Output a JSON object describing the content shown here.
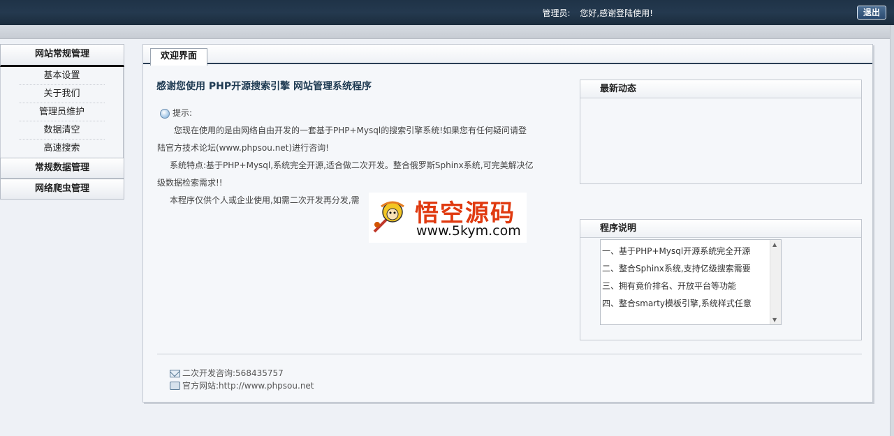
{
  "header": {
    "admin_label": "管理员:",
    "greeting": "您好,感谢登陆使用!",
    "logout_label": "退出"
  },
  "sidebar": {
    "groups": [
      {
        "label": "网站常规管理",
        "items": [
          "基本设置",
          "关于我们",
          "管理员维护",
          "数据清空",
          "高速搜索"
        ]
      },
      {
        "label": "常规数据管理"
      },
      {
        "label": "网络爬虫管理"
      }
    ]
  },
  "main": {
    "tab_label": "欢迎界面",
    "title": "感谢您使用 PHP开源搜索引擎 网站管理系统程序",
    "tip_label": "提示:",
    "paragraphs": [
      "您现在使用的是由网络自由开发的一套基于PHP+Mysql的搜索引擎系统!如果您有任何疑问请登陆官方技术论坛(www.phpsou.net)进行咨询!",
      "系统特点:基于PHP+Mysql,系统完全开源,适合做二次开发。整合俄罗斯Sphinx系统,可完美解决亿级数据检索需求!!",
      "本程序仅供个人或企业使用,如需二次开发再分发,需"
    ],
    "watermark": {
      "cn": "悟空源码",
      "url": "www.5kym.com"
    },
    "news_box": {
      "title": "最新动态"
    },
    "program_box": {
      "title": "程序说明",
      "items": [
        "一、基于PHP+Mysql开源系统完全开源",
        "二、整合Sphinx系统,支持亿级搜索需要",
        "三、拥有竟价排名、开放平台等功能",
        "四、整合smarty模板引擎,系统样式任意"
      ]
    },
    "footer": {
      "consult": "二次开发咨询:568435757",
      "website": "官方网站:http://www.phpsou.net"
    }
  }
}
